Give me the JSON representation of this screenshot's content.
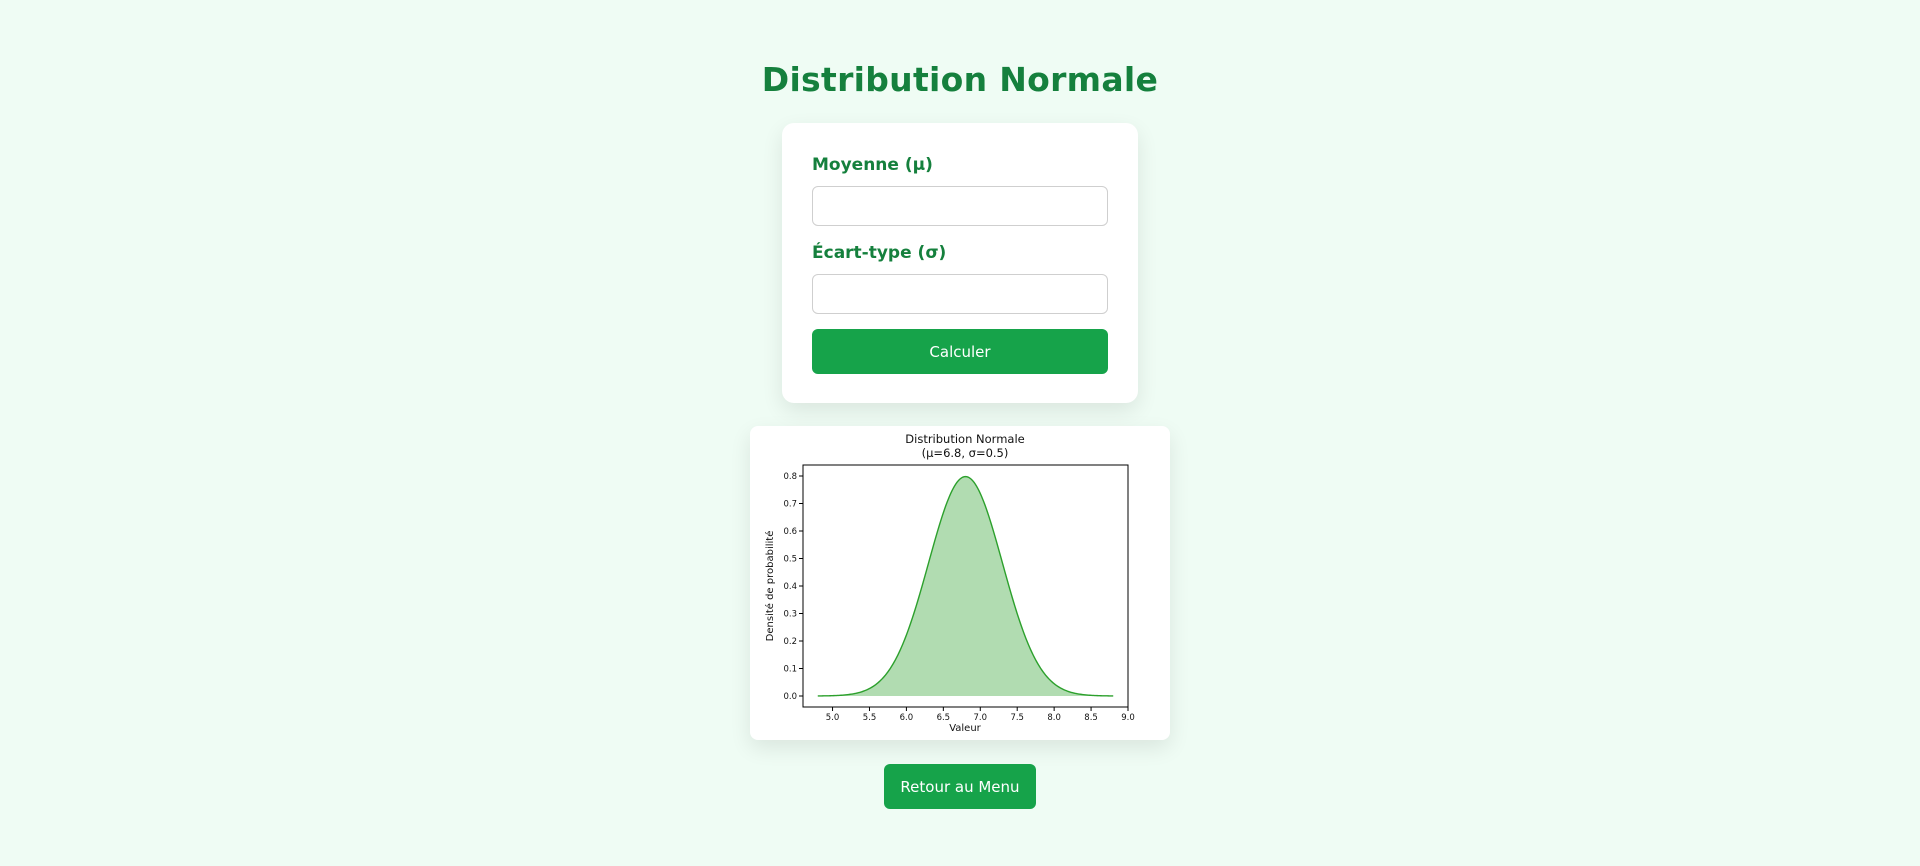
{
  "page": {
    "title": "Distribution Normale"
  },
  "form": {
    "mean": {
      "label": "Moyenne (μ)",
      "value": "",
      "placeholder": ""
    },
    "std": {
      "label": "Écart-type (σ)",
      "value": "",
      "placeholder": ""
    },
    "calculate_label": "Calculer"
  },
  "back_label": "Retour au Menu",
  "colors": {
    "background": "#effcf4",
    "accent": "#15803d",
    "button": "#16a34a",
    "curve": "#2ca02c"
  },
  "chart_data": {
    "type": "area",
    "title_line1": "Distribution Normale",
    "title_line2": "(μ=6.8, σ=0.5)",
    "xlabel": "Valeur",
    "ylabel": "Densité de probabilité",
    "mu": 6.8,
    "sigma": 0.5,
    "x_range": [
      4.8,
      8.8
    ],
    "xlim": [
      4.6,
      9.0
    ],
    "ylim": [
      -0.04,
      0.84
    ],
    "xticks": [
      5.0,
      5.5,
      6.0,
      6.5,
      7.0,
      7.5,
      8.0,
      8.5,
      9.0
    ],
    "xtick_labels": [
      "5.0",
      "5.5",
      "6.0",
      "6.5",
      "7.0",
      "7.5",
      "8.0",
      "8.5",
      "9.0"
    ],
    "yticks": [
      0.0,
      0.1,
      0.2,
      0.3,
      0.4,
      0.5,
      0.6,
      0.7,
      0.8
    ],
    "ytick_labels": [
      "0.0",
      "0.1",
      "0.2",
      "0.3",
      "0.4",
      "0.5",
      "0.6",
      "0.7",
      "0.8"
    ],
    "grid": false
  }
}
